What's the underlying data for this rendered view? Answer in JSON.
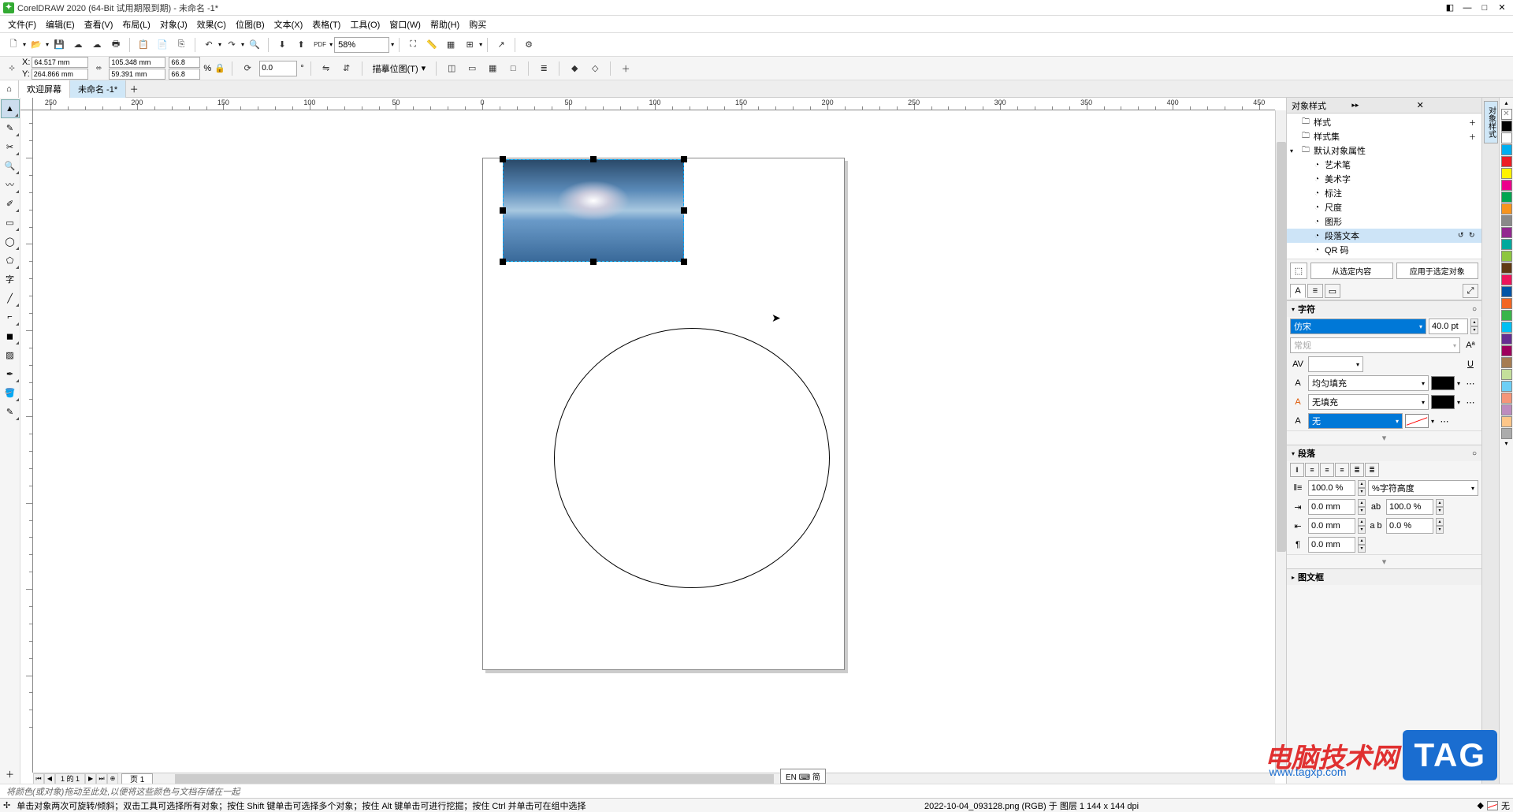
{
  "title": "CorelDRAW 2020 (64-Bit 试用期限到期) - 未命名 -1*",
  "menu": {
    "file": "文件(F)",
    "edit": "编辑(E)",
    "view": "查看(V)",
    "layout": "布局(L)",
    "object": "对象(J)",
    "effects": "效果(C)",
    "bitmap": "位图(B)",
    "text": "文本(X)",
    "table": "表格(T)",
    "tools": "工具(O)",
    "window": "窗口(W)",
    "help": "帮助(H)",
    "buy": "购买"
  },
  "toolbar": {
    "zoom": "58%"
  },
  "prop": {
    "x": "64.517 mm",
    "y": "264.866 mm",
    "w": "105.348 mm",
    "h": "59.391 mm",
    "sx": "66.8",
    "sy": "66.8",
    "pct": "%",
    "rot": "0.0",
    "trace": "描摹位图(T)"
  },
  "tabs": {
    "welcome": "欢迎屏幕",
    "doc": "未命名 -1*"
  },
  "page": {
    "counter": "1 的 1",
    "tab": "页 1"
  },
  "docker": {
    "title": "对象样式",
    "tab_vert": "对象样式",
    "styles": "样式",
    "stylesets": "样式集",
    "default_props": "默认对象属性",
    "artistic": "艺术笔",
    "artText": "美术字",
    "callout": "标注",
    "dimension": "尺度",
    "graphic": "图形",
    "paraText": "段落文本",
    "qr": "QR 码",
    "fromSel": "从选定内容",
    "applySel": "应用于选定对象"
  },
  "char": {
    "title": "字符",
    "font": "仿宋",
    "size": "40.0 pt",
    "regular": "常规",
    "fillMode": "均匀填充",
    "bgMode": "无填充",
    "outlineMode": "无"
  },
  "para": {
    "title": "段落",
    "lineHeight": "100.0 %",
    "lineHeightUnit": "%字符高度",
    "indentLeft": "0.0 mm",
    "charSpacing": "100.0 %",
    "indentRight": "0.0 mm",
    "wordSpacing": "0.0 %",
    "firstLine": "0.0 mm"
  },
  "frame": {
    "title": "图文框"
  },
  "hint": "将颜色(或对象)拖动至此处,以便将这些颜色与文档存储在一起",
  "status": {
    "help1": "单击对象两次可旋转/倾斜；双击工具可选择所有对象；按住 Shift 键单击可选择多个对象；按住 Alt 键单击可进行挖掘；按住 Ctrl 并单击可在组中选择",
    "info": "2022-10-04_093128.png (RGB) 于 图层 1 144 x 144 dpi",
    "fillNone": "无"
  },
  "ime": "EN ⌨ 简",
  "watermark": {
    "text": "电脑技术网",
    "url": "www.tagxp.com",
    "tag": "TAG"
  },
  "palette": [
    "#000000",
    "#ffffff",
    "#00aeef",
    "#ed1c24",
    "#fff200",
    "#ec008c",
    "#00a651",
    "#f7941d",
    "#898989",
    "#92278f",
    "#00a99d",
    "#8dc63f",
    "#603913",
    "#ed145b",
    "#0054a6",
    "#f26522",
    "#39b54a",
    "#00bff3",
    "#662d91",
    "#9e005d",
    "#a67c52",
    "#c4df9b",
    "#6dcff6",
    "#f69679",
    "#bd8cbf",
    "#fdc689",
    "#acacac"
  ]
}
